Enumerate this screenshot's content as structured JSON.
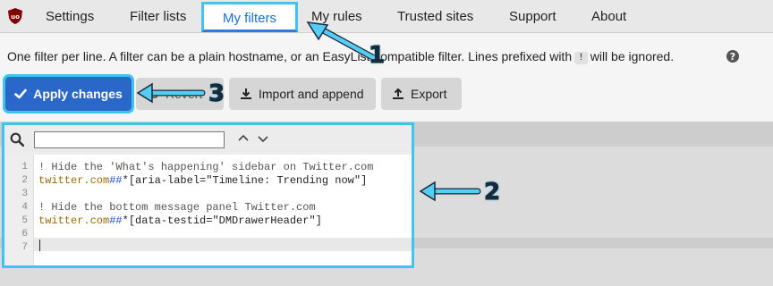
{
  "tabs": [
    {
      "label": "Settings"
    },
    {
      "label": "Filter lists"
    },
    {
      "label": "My filters",
      "active": true
    },
    {
      "label": "My rules"
    },
    {
      "label": "Trusted sites"
    },
    {
      "label": "Support"
    },
    {
      "label": "About"
    }
  ],
  "description": {
    "before": "One filter per line. A filter can be a plain hostname, or an EasyList-compatible filter. Lines prefixed with",
    "kbd": "!",
    "after": "will be ignored."
  },
  "buttons": {
    "apply": "Apply changes",
    "revert": "Revert",
    "import": "Import and append",
    "export": "Export"
  },
  "search": {
    "value": "",
    "placeholder": ""
  },
  "editor": {
    "line_numbers": [
      "1",
      "2",
      "3",
      "4",
      "5",
      "6",
      "7"
    ],
    "lines": [
      {
        "type": "comment",
        "text": "! Hide the 'What's happening' sidebar on Twitter.com"
      },
      {
        "type": "filter",
        "host": "twitter.com",
        "sep": "##",
        "selector": "*[aria-label=\"Timeline: Trending now\"]"
      },
      {
        "type": "empty",
        "text": ""
      },
      {
        "type": "comment",
        "text": "! Hide the bottom message panel Twitter.com"
      },
      {
        "type": "filter",
        "host": "twitter.com",
        "sep": "##",
        "selector": "*[data-testid=\"DMDrawerHeader\"]"
      },
      {
        "type": "empty",
        "text": ""
      },
      {
        "type": "empty",
        "text": ""
      }
    ]
  },
  "annotations": {
    "one": "1",
    "two": "2",
    "three": "3"
  },
  "colors": {
    "accent": "#2a67c9",
    "highlight": "#3fc4f2",
    "tab_active_text": "#1a6fd6"
  },
  "icons": [
    "ublock-logo-icon",
    "help-icon",
    "checkmark-icon",
    "undo-icon",
    "import-icon",
    "export-icon",
    "search-icon",
    "chevron-up-icon",
    "chevron-down-icon"
  ]
}
